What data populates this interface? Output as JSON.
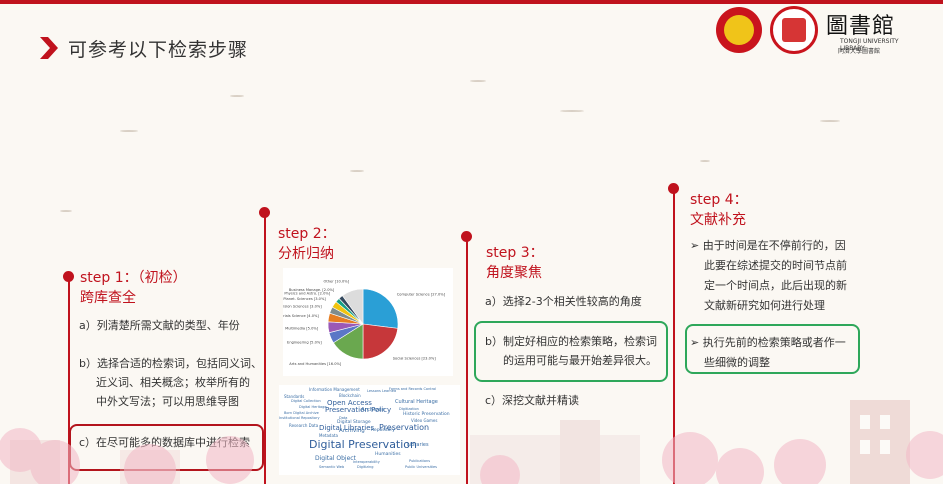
{
  "header": {
    "title": "可参考以下检索步骤"
  },
  "logos": {
    "library_name": "同濟大學圖書館",
    "library_big": "圖書館",
    "library_en": "TONGJI UNIVERSITY LIBRARY"
  },
  "steps": [
    {
      "label": "step 1：（初检）",
      "title": "跨库查全",
      "items": [
        "a）列清楚所需文献的类型、年份",
        "b）选择合适的检索词，包括同义词、",
        "近义词、相关概念；枚举所有的",
        "中外文写法；可以用思维导图",
        "c）在尽可能多的数据库中进行检索"
      ]
    },
    {
      "label": "step 2：",
      "title": "分析归纳"
    },
    {
      "label": "step 3：",
      "title": "角度聚焦",
      "items": [
        "a）选择2-3个相关性较高的角度",
        "b）制定好相应的检索策略，检索词",
        "的运用可能与最开始差异很大。",
        "c）深挖文献并精读"
      ]
    },
    {
      "label": "step 4：",
      "title": "文献补充",
      "items": [
        "➢ 由于时间是在不停前行的，因",
        "此要在综述提交的时间节点前",
        "定一个时间点，此后出现的新",
        "文献新研究如何进行处理",
        "➢ 执行先前的检索策略或者作一",
        "些细微的调整"
      ]
    }
  ],
  "pie": {
    "slices": [
      {
        "label": "Computer Science [27.0%]",
        "value": 27.0,
        "color": "#2a9fd6"
      },
      {
        "label": "Social Sciences [23.0%]",
        "value": 23.0,
        "color": "#c6373a"
      },
      {
        "label": "Arts and Humanities [16.0%]",
        "value": 16.0,
        "color": "#6aa84f"
      },
      {
        "label": "Engineering [5.0%]",
        "value": 5.0,
        "color": "#5b77c6"
      },
      {
        "label": "Multimedia [5.0%]",
        "value": 5.0,
        "color": "#9b59b6"
      },
      {
        "label": "Materials Science [4.0%]",
        "value": 4.0,
        "color": "#e67e22"
      },
      {
        "label": "Decision Sciences [3.0%]",
        "value": 3.0,
        "color": "#7f8c8d"
      },
      {
        "label": "Earth and Planet. Sciences [3.0%]",
        "value": 3.0,
        "color": "#f1c40f"
      },
      {
        "label": "Physics and Astro. [2.0%]",
        "value": 2.0,
        "color": "#16a085"
      },
      {
        "label": "Business Manage. [2.0%]",
        "value": 2.0,
        "color": "#34495e"
      },
      {
        "label": "Other [10.0%]",
        "value": 10.0,
        "color": "#dcdcdc"
      }
    ]
  },
  "wordcloud": {
    "words": [
      "Information Management",
      "Lessons Learned",
      "Forms and Records Control",
      "Standards",
      "Blockchain",
      "Digital Collection",
      "Open Access",
      "Cultural Heritage",
      "Digital Heritage",
      "Preservation Policy",
      "Archives",
      "Digitization",
      "Born Digital Archive",
      "Historic Preservation",
      "Institutional Repository",
      "Data",
      "Digital Storage",
      "Video Games",
      "Research Data",
      "Digital Libraries",
      "Preservation",
      "Archiving",
      "Repository",
      "Metadata",
      "Digital Preservation",
      "Libraries",
      "Digital Object",
      "Humanities",
      "Interoperability",
      "Publications",
      "Semantic Web",
      "Digitizing",
      "Public Universities"
    ]
  }
}
